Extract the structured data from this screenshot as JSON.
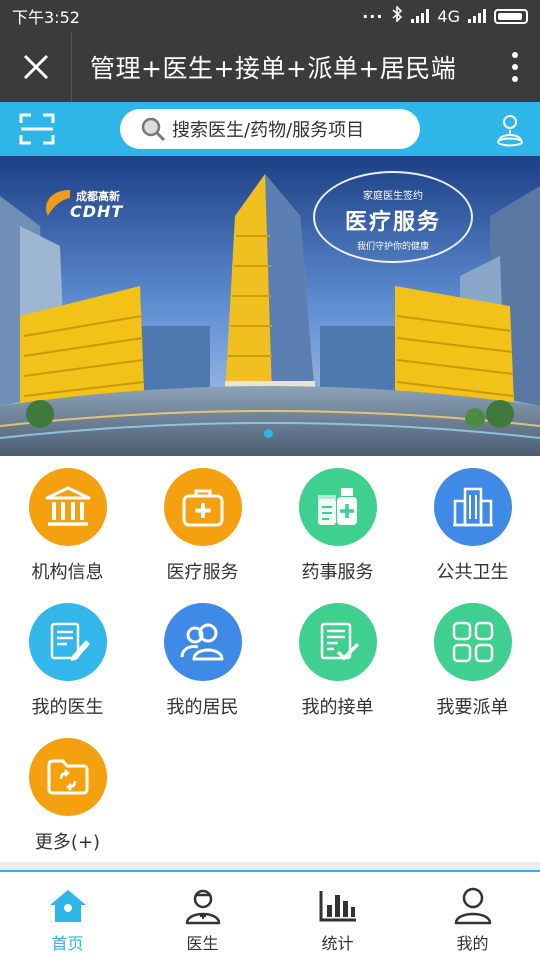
{
  "status_bar": {
    "time": "下午3:52",
    "network": "4G"
  },
  "title_bar": {
    "title": "管理+医生+接单+派单+居民端"
  },
  "search": {
    "placeholder": "搜索医生/药物/服务项目"
  },
  "banner": {
    "logo_cn": "成都高新",
    "logo_en": "CDHT",
    "badge_top": "家庭医生签约",
    "badge_main": "医疗服务",
    "badge_sub": "我们守护你的健康"
  },
  "grid": [
    {
      "label": "机构信息",
      "icon": "institution-icon",
      "color": "#f5a00f"
    },
    {
      "label": "医疗服务",
      "icon": "medical-kit-icon",
      "color": "#f5a00f"
    },
    {
      "label": "药事服务",
      "icon": "medicine-icon",
      "color": "#3fcf8e"
    },
    {
      "label": "公共卫生",
      "icon": "building-icon",
      "color": "#3e8ae6"
    },
    {
      "label": "我的医生",
      "icon": "note-pen-icon",
      "color": "#33b6ea"
    },
    {
      "label": "我的居民",
      "icon": "users-icon",
      "color": "#3e8ae6"
    },
    {
      "label": "我的接单",
      "icon": "checklist-icon",
      "color": "#3fcf8e"
    },
    {
      "label": "我要派单",
      "icon": "grid-icon",
      "color": "#3fcf8e"
    },
    {
      "label": "更多(+)",
      "icon": "folder-icon",
      "color": "#f5a00f"
    }
  ],
  "tabs": [
    {
      "label": "首页",
      "icon": "home-icon",
      "active": true
    },
    {
      "label": "医生",
      "icon": "doctor-icon",
      "active": false
    },
    {
      "label": "统计",
      "icon": "bar-chart-icon",
      "active": false
    },
    {
      "label": "我的",
      "icon": "profile-icon",
      "active": false
    }
  ],
  "colors": {
    "accent": "#2eb6e8",
    "header": "#3b3b3b",
    "orange": "#f5a00f",
    "green": "#3fcf8e",
    "blue": "#3e8ae6"
  }
}
